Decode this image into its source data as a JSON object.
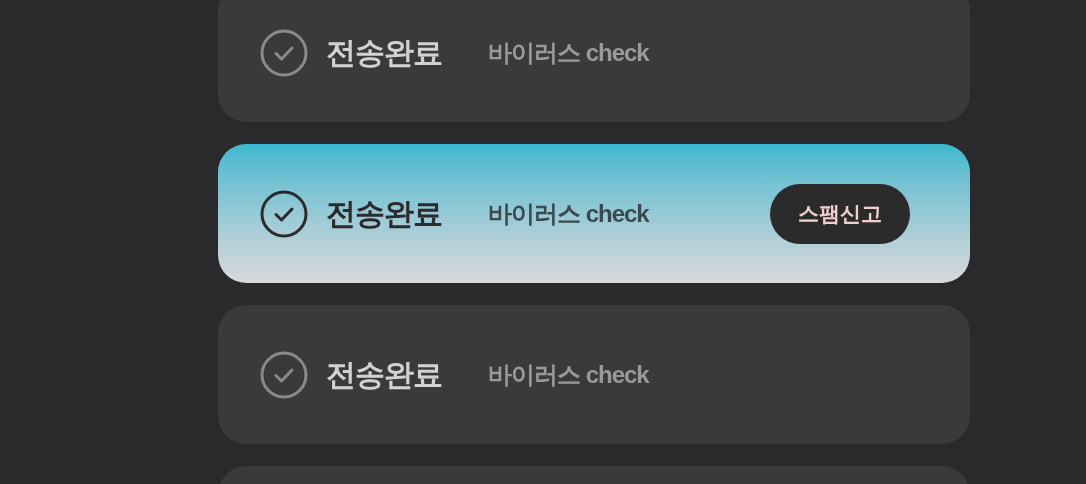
{
  "items": [
    {
      "kind": "row",
      "status": "전송완료",
      "note": "바이러스 check",
      "selected": false
    },
    {
      "kind": "row",
      "status": "전송완료",
      "note": "바이러스 check",
      "selected": true,
      "action": "스팸신고"
    },
    {
      "kind": "row",
      "status": "전송완료",
      "note": "바이러스 check",
      "selected": false
    },
    {
      "kind": "edge"
    }
  ]
}
